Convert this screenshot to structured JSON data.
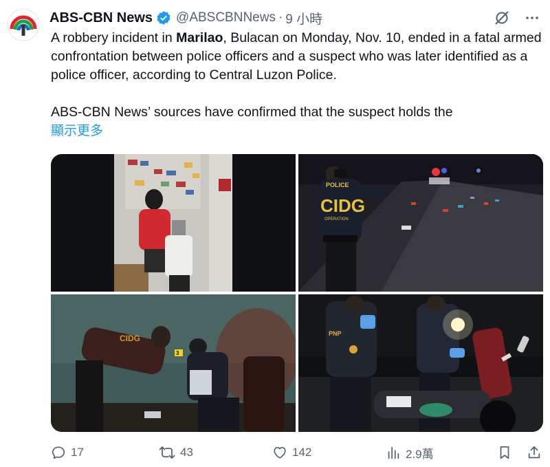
{
  "author": {
    "name": "ABS-CBN News",
    "handle": "@ABSCBNNews",
    "separator": "·",
    "time": "9 小時",
    "avatar_icon": "abs-cbn-logo"
  },
  "tweet": {
    "text_before_bold": "A robbery incident in ",
    "bold": "Marilao",
    "text_after_bold": ", Bulacan on Monday, Nov. 10, ended in a fatal armed confrontation between police officers and a suspect who was later identified as a police officer, according to Central Luzon Police.",
    "paragraph2": "ABS-CBN News’ sources have confirmed that the suspect holds the",
    "show_more": "顯示更多"
  },
  "media": {
    "photo2_vest_text": "POLICE",
    "photo2_unit_text": "CIDG",
    "photo2_sub_text": "OPERATION",
    "photo3_marker": "3"
  },
  "actions": {
    "replies": "17",
    "reposts": "43",
    "likes": "142",
    "views": "2.9萬"
  },
  "colors": {
    "accent": "#1d9bf0",
    "muted": "#536471",
    "text": "#0f1419"
  }
}
